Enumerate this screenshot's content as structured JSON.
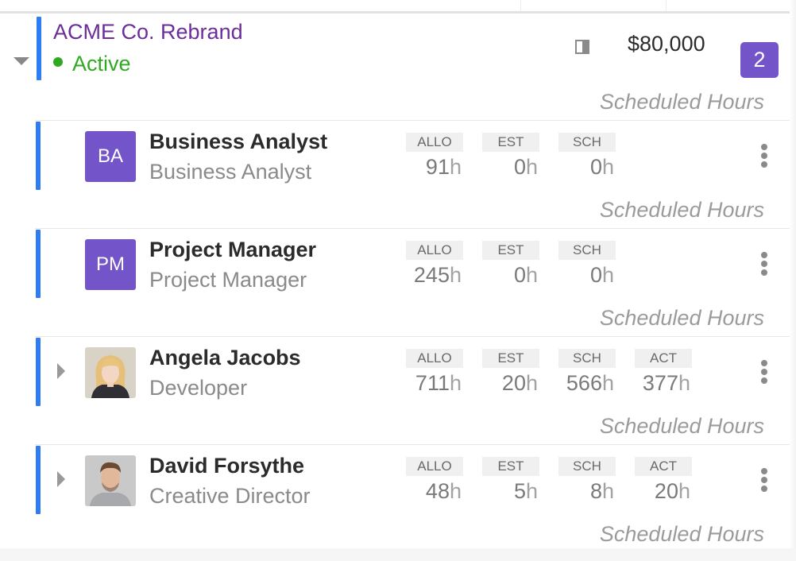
{
  "project": {
    "name": "ACME Co. Rebrand",
    "status": "Active",
    "budget": "$80,000",
    "member_count": "2",
    "scheduled_hours_label": "Scheduled Hours",
    "colors": {
      "accent_bar": "#2f7df6",
      "name": "#6a2d9a",
      "status": "#2faa20",
      "badge": "#7355c9"
    }
  },
  "stat_labels": {
    "allo": "ALLO",
    "est": "EST",
    "sch": "SCH",
    "act": "ACT"
  },
  "unit": "h",
  "rows": [
    {
      "initials": "BA",
      "name": "Business Analyst",
      "role": "Business Analyst",
      "allo": "91",
      "est": "0",
      "sch": "0",
      "scheduled_label": "Scheduled Hours"
    },
    {
      "initials": "PM",
      "name": "Project Manager",
      "role": "Project Manager",
      "allo": "245",
      "est": "0",
      "sch": "0",
      "scheduled_label": "Scheduled Hours"
    },
    {
      "name": "Angela Jacobs",
      "role": "Developer",
      "allo": "711",
      "est": "20",
      "sch": "566",
      "act": "377",
      "scheduled_label": "Scheduled Hours"
    },
    {
      "name": "David Forsythe",
      "role": "Creative Director",
      "allo": "48",
      "est": "5",
      "sch": "8",
      "act": "20",
      "scheduled_label": "Scheduled Hours"
    }
  ]
}
